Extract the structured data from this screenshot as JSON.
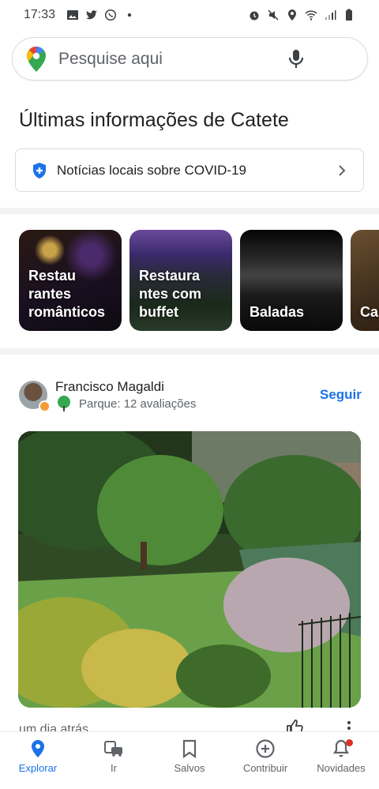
{
  "status_bar": {
    "time": "17:33"
  },
  "search": {
    "placeholder": "Pesquise aqui"
  },
  "section_title": "Últimas informações de Catete",
  "covid": {
    "label": "Notícias locais sobre COVID-19"
  },
  "categories": [
    {
      "label": "Restau rantes românticos"
    },
    {
      "label": "Restaura ntes com buffet"
    },
    {
      "label": "Baladas"
    },
    {
      "label": "Ca ma cria"
    }
  ],
  "post": {
    "author": "Francisco Magaldi",
    "meta": "Parque: 12 avaliações",
    "follow_label": "Seguir",
    "time": "um dia atrás"
  },
  "nav": {
    "items": [
      {
        "label": "Explorar",
        "icon": "location-pin-icon",
        "active": true
      },
      {
        "label": "Ir",
        "icon": "commute-icon"
      },
      {
        "label": "Salvos",
        "icon": "bookmark-icon"
      },
      {
        "label": "Contribuir",
        "icon": "add-circle-icon"
      },
      {
        "label": "Novidades",
        "icon": "bell-icon"
      }
    ]
  },
  "colors": {
    "accent": "#1a73e8",
    "notification": "#d93025"
  }
}
